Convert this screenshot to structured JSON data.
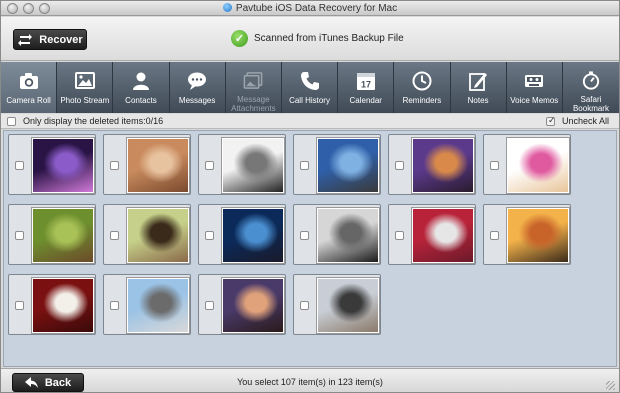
{
  "window": {
    "title": "Pavtube iOS Data Recovery for Mac"
  },
  "header": {
    "recover_label": "Recover",
    "status_text": "Scanned from iTunes Backup File"
  },
  "toolbar": {
    "items": [
      {
        "label": "Camera Roll",
        "icon": "camera-icon",
        "active": true
      },
      {
        "label": "Photo Stream",
        "icon": "photo-stream-icon"
      },
      {
        "label": "Contacts",
        "icon": "contacts-icon"
      },
      {
        "label": "Messages",
        "icon": "messages-icon"
      },
      {
        "label": "Message Attachments",
        "icon": "attachments-icon",
        "disabled": true
      },
      {
        "label": "Call History",
        "icon": "phone-icon"
      },
      {
        "label": "Calendar",
        "icon": "calendar-icon",
        "day": "17"
      },
      {
        "label": "Reminders",
        "icon": "clock-icon"
      },
      {
        "label": "Notes",
        "icon": "notes-icon"
      },
      {
        "label": "Voice Memos",
        "icon": "voice-memo-icon"
      },
      {
        "label": "Safari Bookmark",
        "icon": "safari-bookmark-icon"
      }
    ]
  },
  "filter": {
    "deleted_only_label": "Only display the deleted items:0/16",
    "uncheck_all_label": "Uncheck All"
  },
  "photos": [
    {
      "row": 0,
      "col": 0,
      "subject": "concert-lights-photo",
      "colors": [
        "#2a1445",
        "#8b5cc9",
        "#d07ad9"
      ]
    },
    {
      "row": 0,
      "col": 1,
      "subject": "baby-face-photo",
      "colors": [
        "#c98b5e",
        "#e8c3a0",
        "#7a4a2e"
      ]
    },
    {
      "row": 0,
      "col": 2,
      "subject": "bw-portrait-pair-photo",
      "colors": [
        "#f2f2f2",
        "#777777",
        "#222222"
      ]
    },
    {
      "row": 0,
      "col": 3,
      "subject": "statue-sky-photo",
      "colors": [
        "#2f5fa8",
        "#7fb1e3",
        "#3a3a3a"
      ]
    },
    {
      "row": 0,
      "col": 4,
      "subject": "eye-makeup-photo",
      "colors": [
        "#5b3a8c",
        "#d98a4a",
        "#2a1b2e"
      ]
    },
    {
      "row": 0,
      "col": 5,
      "subject": "beyonce-poster-photo",
      "colors": [
        "#ffffff",
        "#e05aa0",
        "#e8c59b"
      ]
    },
    {
      "row": 1,
      "col": 0,
      "subject": "bear-grass-photo",
      "colors": [
        "#6e8f2e",
        "#a8c257",
        "#6b4a2a"
      ]
    },
    {
      "row": 1,
      "col": 1,
      "subject": "woman-field-photo",
      "colors": [
        "#c6d08a",
        "#3a2a1a",
        "#8a6a4a"
      ]
    },
    {
      "row": 1,
      "col": 2,
      "subject": "castle-night-photo",
      "colors": [
        "#0b2a5a",
        "#4a8fd0",
        "#1a1a2a"
      ]
    },
    {
      "row": 1,
      "col": 3,
      "subject": "bw-baby-photo",
      "colors": [
        "#d6d6d6",
        "#666666",
        "#1a1a1a"
      ]
    },
    {
      "row": 1,
      "col": 4,
      "subject": "graduation-crowd-photo",
      "colors": [
        "#b8233a",
        "#e6e6e6",
        "#6a1a2a"
      ]
    },
    {
      "row": 1,
      "col": 5,
      "subject": "sunset-tree-photo",
      "colors": [
        "#f3b24a",
        "#c8632a",
        "#3a2a1a"
      ]
    },
    {
      "row": 2,
      "col": 0,
      "subject": "pope-waving-photo",
      "colors": [
        "#7a1010",
        "#f3f0ea",
        "#3a0a0a"
      ]
    },
    {
      "row": 2,
      "col": 1,
      "subject": "airshow-plane-photo",
      "colors": [
        "#9bc3e6",
        "#6b6b6b",
        "#d8d8d8"
      ]
    },
    {
      "row": 2,
      "col": 2,
      "subject": "two-women-photo",
      "colors": [
        "#4a3a6a",
        "#e0a27a",
        "#2a1a1a"
      ]
    },
    {
      "row": 2,
      "col": 3,
      "subject": "three-men-photo",
      "colors": [
        "#c9ced6",
        "#3a3a3a",
        "#8a7a6a"
      ]
    }
  ],
  "footer": {
    "back_label": "Back",
    "summary_text": "You select 107 item(s) in 123 item(s)"
  }
}
